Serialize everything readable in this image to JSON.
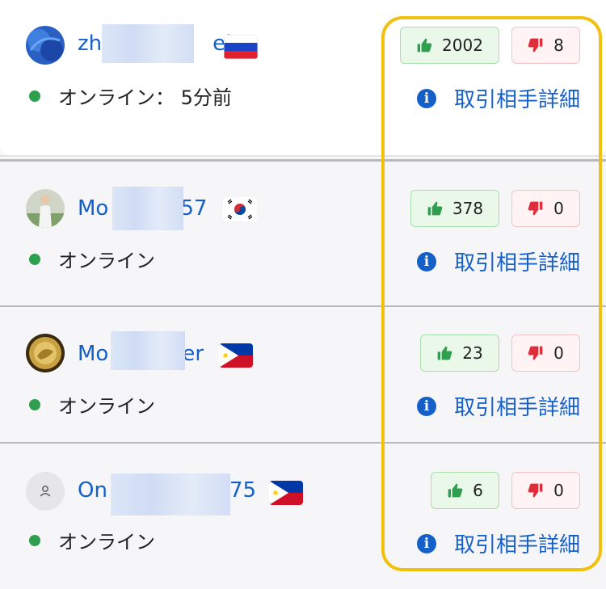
{
  "sellers": [
    {
      "username_start": "zh",
      "username_end": "ei",
      "flag": "russia",
      "status": "オンライン： 5分前",
      "likes": "2002",
      "dislikes": "8",
      "details_label": "取引相手詳細"
    },
    {
      "username_start": "Mo",
      "username_end": "57",
      "flag": "south-korea",
      "status": "オンライン",
      "likes": "378",
      "dislikes": "0",
      "details_label": "取引相手詳細"
    },
    {
      "username_start": "Mo",
      "username_end": "er",
      "flag": "philippines",
      "status": "オンライン",
      "likes": "23",
      "dislikes": "0",
      "details_label": "取引相手詳細"
    },
    {
      "username_start": "On",
      "username_end": "75",
      "flag": "philippines",
      "status": "オンライン",
      "likes": "6",
      "dislikes": "0",
      "details_label": "取引相手詳細"
    }
  ],
  "colors": {
    "link": "#1560c8",
    "online": "#2f9e4f",
    "highlight": "#f2c10f"
  },
  "icons": [
    "thumbs-up-icon",
    "thumbs-down-icon",
    "info-icon"
  ]
}
